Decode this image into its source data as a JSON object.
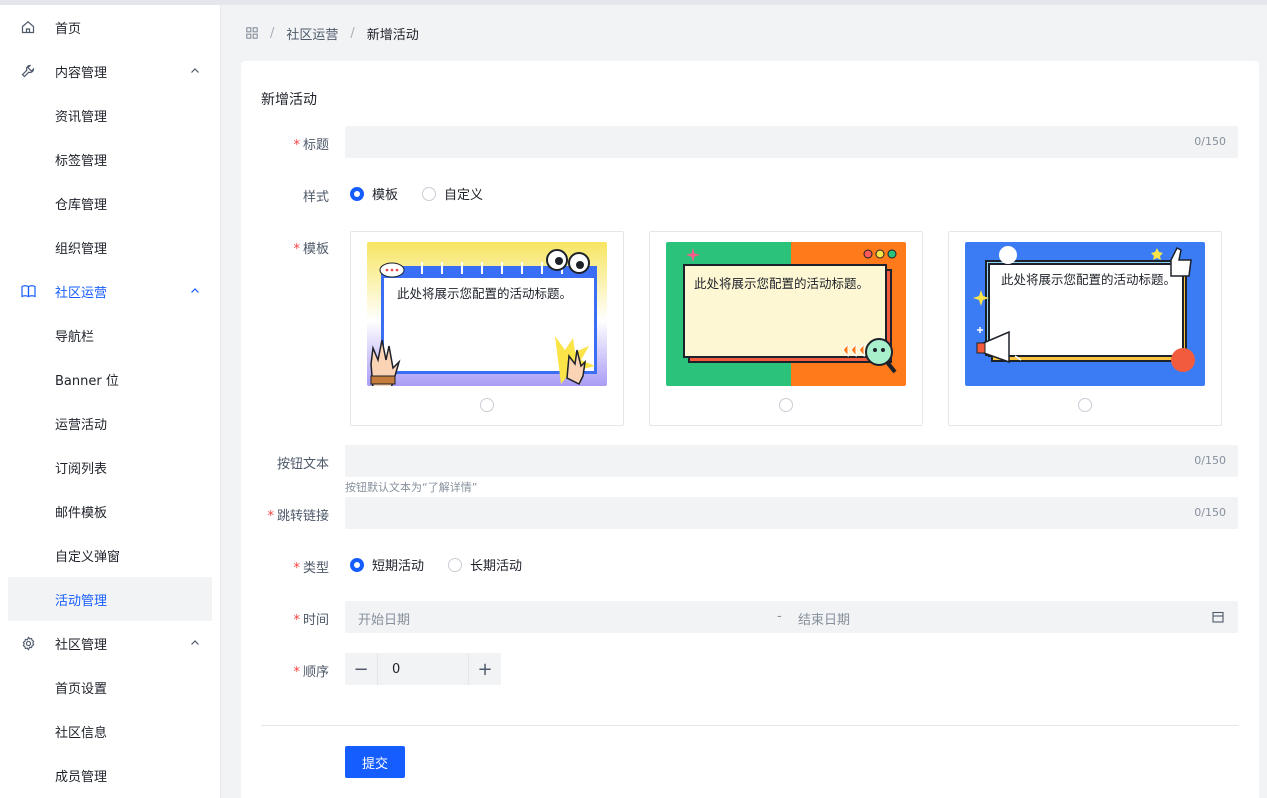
{
  "sidebar": {
    "items": [
      {
        "label": "首页",
        "icon": "home-icon"
      },
      {
        "label": "内容管理",
        "icon": "wrench-icon"
      },
      {
        "label": "资讯管理"
      },
      {
        "label": "标签管理"
      },
      {
        "label": "仓库管理"
      },
      {
        "label": "组织管理"
      },
      {
        "label": "社区运营",
        "icon": "book-icon"
      },
      {
        "label": "导航栏"
      },
      {
        "label": "Banner 位"
      },
      {
        "label": "运营活动"
      },
      {
        "label": "订阅列表"
      },
      {
        "label": "邮件模板"
      },
      {
        "label": "自定义弹窗"
      },
      {
        "label": "活动管理"
      },
      {
        "label": "社区管理",
        "icon": "gear-icon"
      },
      {
        "label": "首页设置"
      },
      {
        "label": "社区信息"
      },
      {
        "label": "成员管理"
      }
    ]
  },
  "breadcrumb": {
    "icon": "apps-icon",
    "parent": "社区运营",
    "current": "新增活动"
  },
  "form": {
    "title": "新增活动",
    "fields": {
      "title_label": "标题",
      "title_count": "0/150",
      "style_label": "样式",
      "style_options": [
        "模板",
        "自定义"
      ],
      "template_label": "模板",
      "template_text": "此处将展示您配置的活动标题。",
      "button_text_label": "按钮文本",
      "button_text_count": "0/150",
      "button_text_hint": "按钮默认文本为“了解详情”",
      "link_label": "跳转链接",
      "link_count": "0/150",
      "type_label": "类型",
      "type_options": [
        "短期活动",
        "长期活动"
      ],
      "time_label": "时间",
      "start_placeholder": "开始日期",
      "range_sep": "-",
      "end_placeholder": "结束日期",
      "order_label": "顺序",
      "order_value": "0",
      "minus": "−",
      "plus": "+"
    },
    "submit_label": "提交"
  },
  "colors": {
    "primary": "#165dff",
    "required": "#f53f3f"
  }
}
